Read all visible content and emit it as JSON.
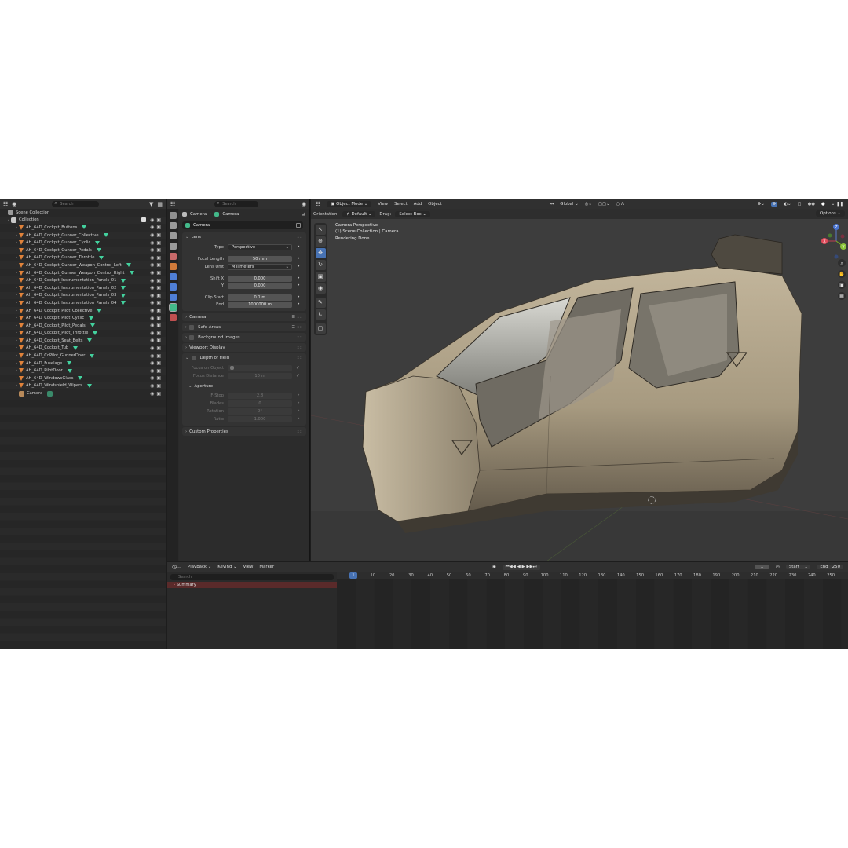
{
  "outliner": {
    "search_placeholder": "Search",
    "scene_collection": "Scene Collection",
    "collection": "Collection",
    "objects": [
      {
        "name": "AH_64D_Cockpit_Buttons",
        "type": "mesh"
      },
      {
        "name": "AH_64D_Cockpit_Gunner_Collective",
        "type": "mesh"
      },
      {
        "name": "AH_64D_Cockpit_Gunner_Cyclic",
        "type": "mesh"
      },
      {
        "name": "AH_64D_Cockpit_Gunner_Pedals",
        "type": "mesh"
      },
      {
        "name": "AH_64D_Cockpit_Gunner_Throttle",
        "type": "mesh"
      },
      {
        "name": "AH_64D_Cockpit_Gunner_Weapon_Control_Left",
        "type": "mesh"
      },
      {
        "name": "AH_64D_Cockpit_Gunner_Weapon_Control_Right",
        "type": "mesh"
      },
      {
        "name": "AH_64D_Cockpit_Instrumentation_Panels_01",
        "type": "mesh"
      },
      {
        "name": "AH_64D_Cockpit_Instrumentation_Panels_02",
        "type": "mesh"
      },
      {
        "name": "AH_64D_Cockpit_Instrumentation_Panels_03",
        "type": "mesh"
      },
      {
        "name": "AH_64D_Cockpit_Instrumentation_Panels_04",
        "type": "mesh"
      },
      {
        "name": "AH_64D_Cockpit_Pilot_Collective",
        "type": "mesh"
      },
      {
        "name": "AH_64D_Cockpit_Pilot_Cyclic",
        "type": "mesh"
      },
      {
        "name": "AH_64D_Cockpit_Pilot_Pedals",
        "type": "mesh"
      },
      {
        "name": "AH_64D_Cockpit_Pilot_Throttle",
        "type": "mesh"
      },
      {
        "name": "AH_64D_Cockpit_Seat_Belts",
        "type": "mesh"
      },
      {
        "name": "AH_64D_Cockpit_Tub",
        "type": "mesh"
      },
      {
        "name": "AH_64D_CoPilot_GunnerDoor",
        "type": "mesh"
      },
      {
        "name": "AH_64D_Fuselage",
        "type": "mesh"
      },
      {
        "name": "AH_64D_PilotDoor",
        "type": "mesh"
      },
      {
        "name": "AH_64D_WindowsGlass",
        "type": "mesh"
      },
      {
        "name": "AH_64D_Windshield_Wipers",
        "type": "mesh"
      },
      {
        "name": "Camera",
        "type": "camera"
      }
    ]
  },
  "properties": {
    "search_placeholder": "Search",
    "breadcrumb": [
      "Camera",
      "Camera"
    ],
    "datablock_name": "Camera",
    "lens": {
      "title": "Lens",
      "type_label": "Type",
      "type_value": "Perspective",
      "focal_label": "Focal Length",
      "focal_value": "50 mm",
      "unit_label": "Lens Unit",
      "unit_value": "Millimeters",
      "shiftx_label": "Shift X",
      "shiftx_value": "0.000",
      "shifty_label": "Y",
      "shifty_value": "0.000",
      "clipstart_label": "Clip Start",
      "clipstart_value": "0.1 m",
      "clipend_label": "End",
      "clipend_value": "1000000 m"
    },
    "panels": {
      "camera": "Camera",
      "safe_areas": "Safe Areas",
      "background_images": "Background Images",
      "viewport_display": "Viewport Display",
      "depth_of_field": "Depth of Field",
      "custom_properties": "Custom Properties"
    },
    "dof": {
      "focus_object_label": "Focus on Object",
      "focus_distance_label": "Focus Distance",
      "focus_distance_value": "10 m",
      "aperture_title": "Aperture",
      "fstop_label": "F-Stop",
      "fstop_value": "2.8",
      "blades_label": "Blades",
      "blades_value": "0",
      "rotation_label": "Rotation",
      "rotation_value": "0°",
      "ratio_label": "Ratio",
      "ratio_value": "1.000"
    }
  },
  "viewport": {
    "mode": "Object Mode",
    "menus": [
      "View",
      "Select",
      "Add",
      "Object"
    ],
    "transform": "Global",
    "orientation_label": "Orientation:",
    "orientation_value": "Default",
    "drag_label": "Drag:",
    "drag_value": "Select Box",
    "options": "Options",
    "info": [
      "Camera Perspective",
      "(1) Scene Collection | Camera",
      "Rendering Done"
    ],
    "gizmo_axes": {
      "x": "X",
      "y": "Y",
      "z": "Z"
    }
  },
  "timeline": {
    "menus": [
      "Playback",
      "Keying",
      "View",
      "Marker"
    ],
    "current_frame": "1",
    "start_label": "Start",
    "start_value": "1",
    "end_label": "End",
    "end_value": "250",
    "search_placeholder": "Search",
    "summary": "Summary",
    "ruler_frames": [
      "1",
      "10",
      "20",
      "30",
      "40",
      "50",
      "60",
      "70",
      "80",
      "90",
      "100",
      "110",
      "120",
      "130",
      "140",
      "150",
      "160",
      "170",
      "180",
      "190",
      "200",
      "210",
      "220",
      "230",
      "240",
      "250"
    ],
    "playhead_frame": "1"
  },
  "colors": {
    "accent": "#4772b3",
    "mesh_icon": "#e0823a",
    "modifier_icon": "#43d19e",
    "fuselage": "#b8a98e"
  }
}
